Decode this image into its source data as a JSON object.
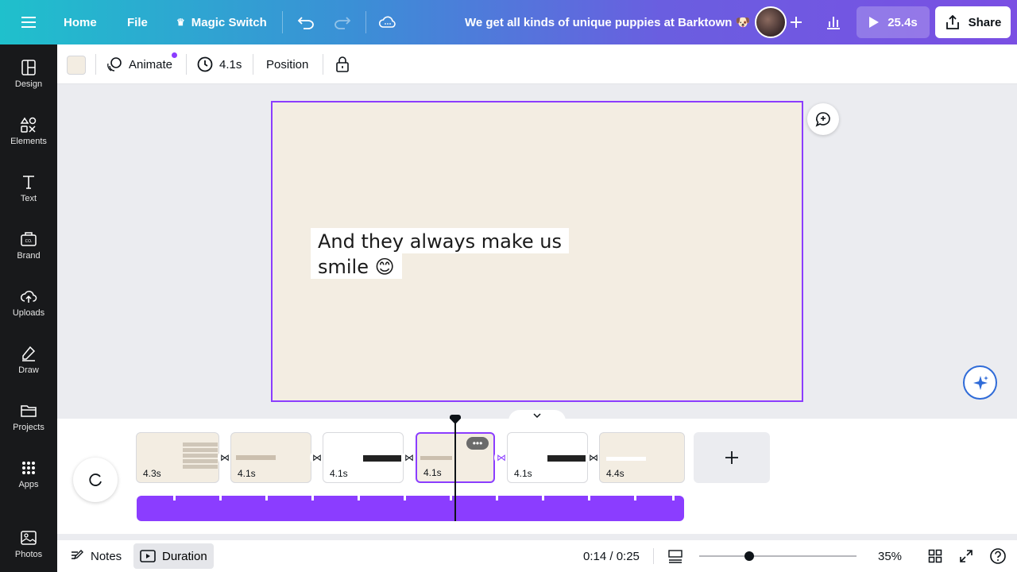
{
  "topbar": {
    "home": "Home",
    "file": "File",
    "magic_switch": "Magic Switch",
    "title": "We get all kinds of unique puppies at Barktown 🐶",
    "play_duration": "25.4s",
    "share": "Share"
  },
  "sidebar": {
    "items": [
      {
        "label": "Design",
        "icon": "design-icon"
      },
      {
        "label": "Elements",
        "icon": "elements-icon"
      },
      {
        "label": "Text",
        "icon": "text-icon"
      },
      {
        "label": "Brand",
        "icon": "brand-icon"
      },
      {
        "label": "Uploads",
        "icon": "uploads-icon"
      },
      {
        "label": "Draw",
        "icon": "draw-icon"
      },
      {
        "label": "Projects",
        "icon": "projects-icon"
      },
      {
        "label": "Apps",
        "icon": "apps-icon"
      },
      {
        "label": "Photos",
        "icon": "photos-icon"
      }
    ]
  },
  "toolbar": {
    "background_color": "#f3ede2",
    "animate": "Animate",
    "duration": "4.1s",
    "position": "Position"
  },
  "canvas": {
    "line1": "And they always make us",
    "line2": "smile 😊",
    "background_color": "#f3ede2",
    "selection_color": "#8b3dff"
  },
  "timeline": {
    "clips": [
      {
        "duration": "4.3s"
      },
      {
        "duration": "4.1s"
      },
      {
        "duration": "4.1s"
      },
      {
        "duration": "4.1s"
      },
      {
        "duration": "4.1s"
      },
      {
        "duration": "4.4s"
      }
    ],
    "more": "•••"
  },
  "bottom": {
    "notes": "Notes",
    "duration": "Duration",
    "time": "0:14 / 0:25",
    "zoom": "35%",
    "zoom_level": 0.32
  },
  "colors": {
    "accent": "#8b3dff",
    "sidebar_bg": "#18191b"
  }
}
